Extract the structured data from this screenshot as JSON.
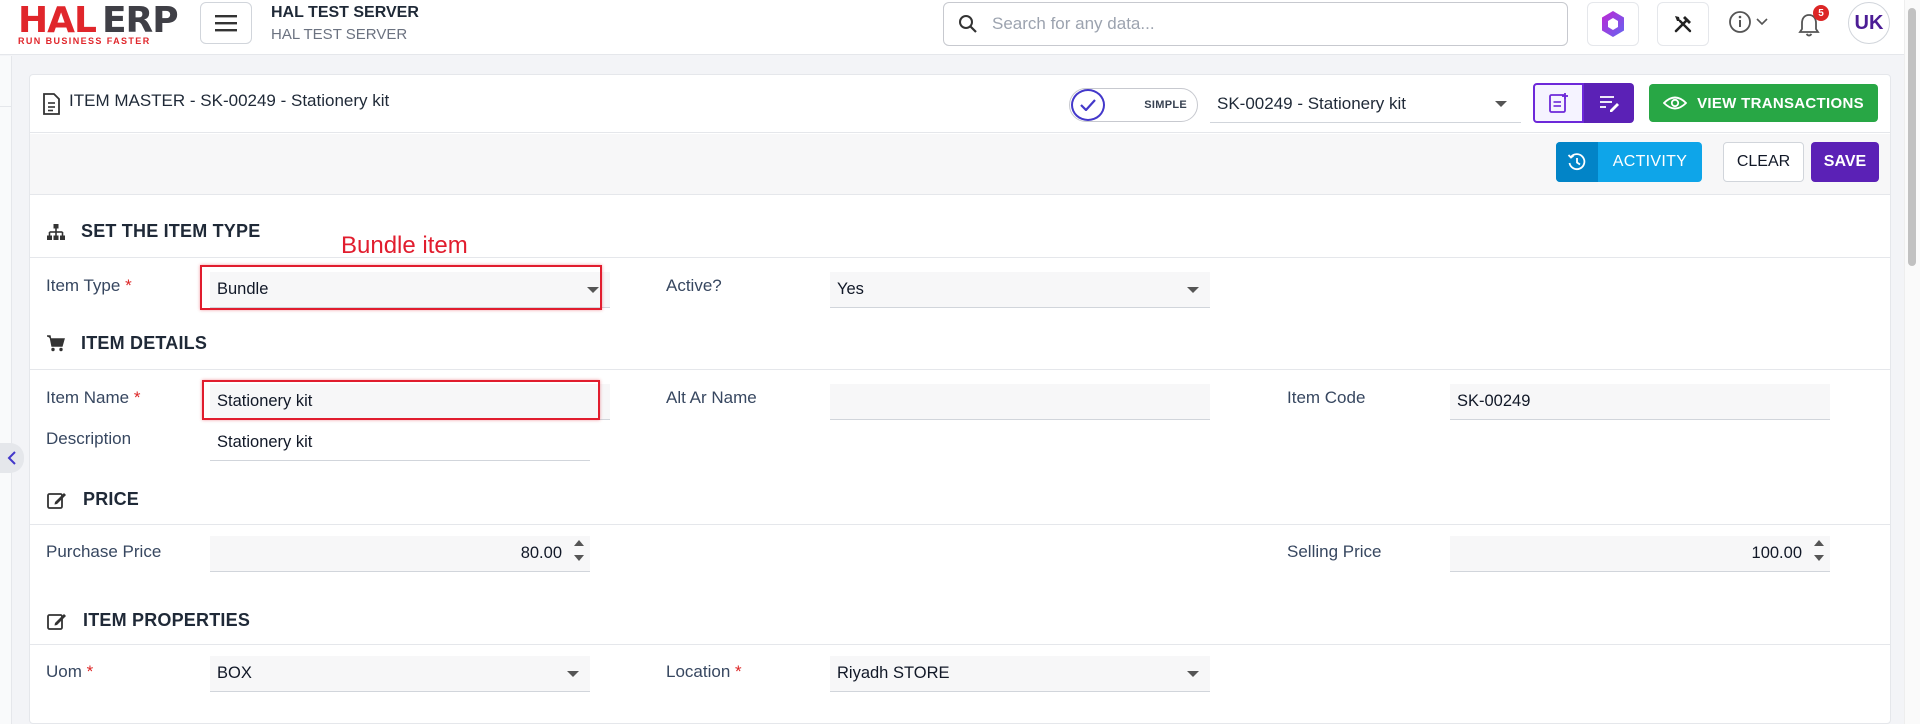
{
  "app": {
    "logo_main": "HAL",
    "logo_second": "ERP",
    "logo_tagline": "RUN BUSINESS FASTER",
    "server_title": "HAL TEST SERVER",
    "server_subtitle": "HAL TEST SERVER",
    "search_placeholder": "Search for any data...",
    "notification_count": "5",
    "user_initials": "UK"
  },
  "page": {
    "title": "ITEM MASTER - SK-00249 - Stationery kit",
    "mode_label": "SIMPLE",
    "record_select": "SK-00249 - Stationery kit",
    "view_transactions_label": "VIEW TRANSACTIONS",
    "activity_label": "ACTIVITY",
    "clear_label": "CLEAR",
    "save_label": "SAVE"
  },
  "sections": {
    "item_type": {
      "title": "SET THE ITEM TYPE",
      "item_type_label": "Item Type",
      "item_type_value": "Bundle",
      "active_label": "Active?",
      "active_value": "Yes"
    },
    "item_details": {
      "title": "ITEM DETAILS",
      "item_name_label": "Item Name",
      "item_name_value": "Stationery kit",
      "alt_ar_name_label": "Alt Ar Name",
      "alt_ar_name_value": "",
      "item_code_label": "Item Code",
      "item_code_value": "SK-00249",
      "description_label": "Description",
      "description_value": "Stationery kit"
    },
    "price": {
      "title": "PRICE",
      "purchase_price_label": "Purchase Price",
      "purchase_price_value": "80.00",
      "selling_price_label": "Selling Price",
      "selling_price_value": "100.00"
    },
    "item_properties": {
      "title": "ITEM PROPERTIES",
      "uom_label": "Uom",
      "uom_value": "BOX",
      "location_label": "Location",
      "location_value": "Riyadh STORE"
    }
  },
  "annotation": {
    "bundle_note": "Bundle item"
  },
  "colors": {
    "brand_red": "#e0262b",
    "primary_purple": "#5b21b6",
    "success_green": "#28a745",
    "info_blue": "#0ea5e9",
    "annotation_red": "#e11d2e"
  },
  "required_mark": "*"
}
